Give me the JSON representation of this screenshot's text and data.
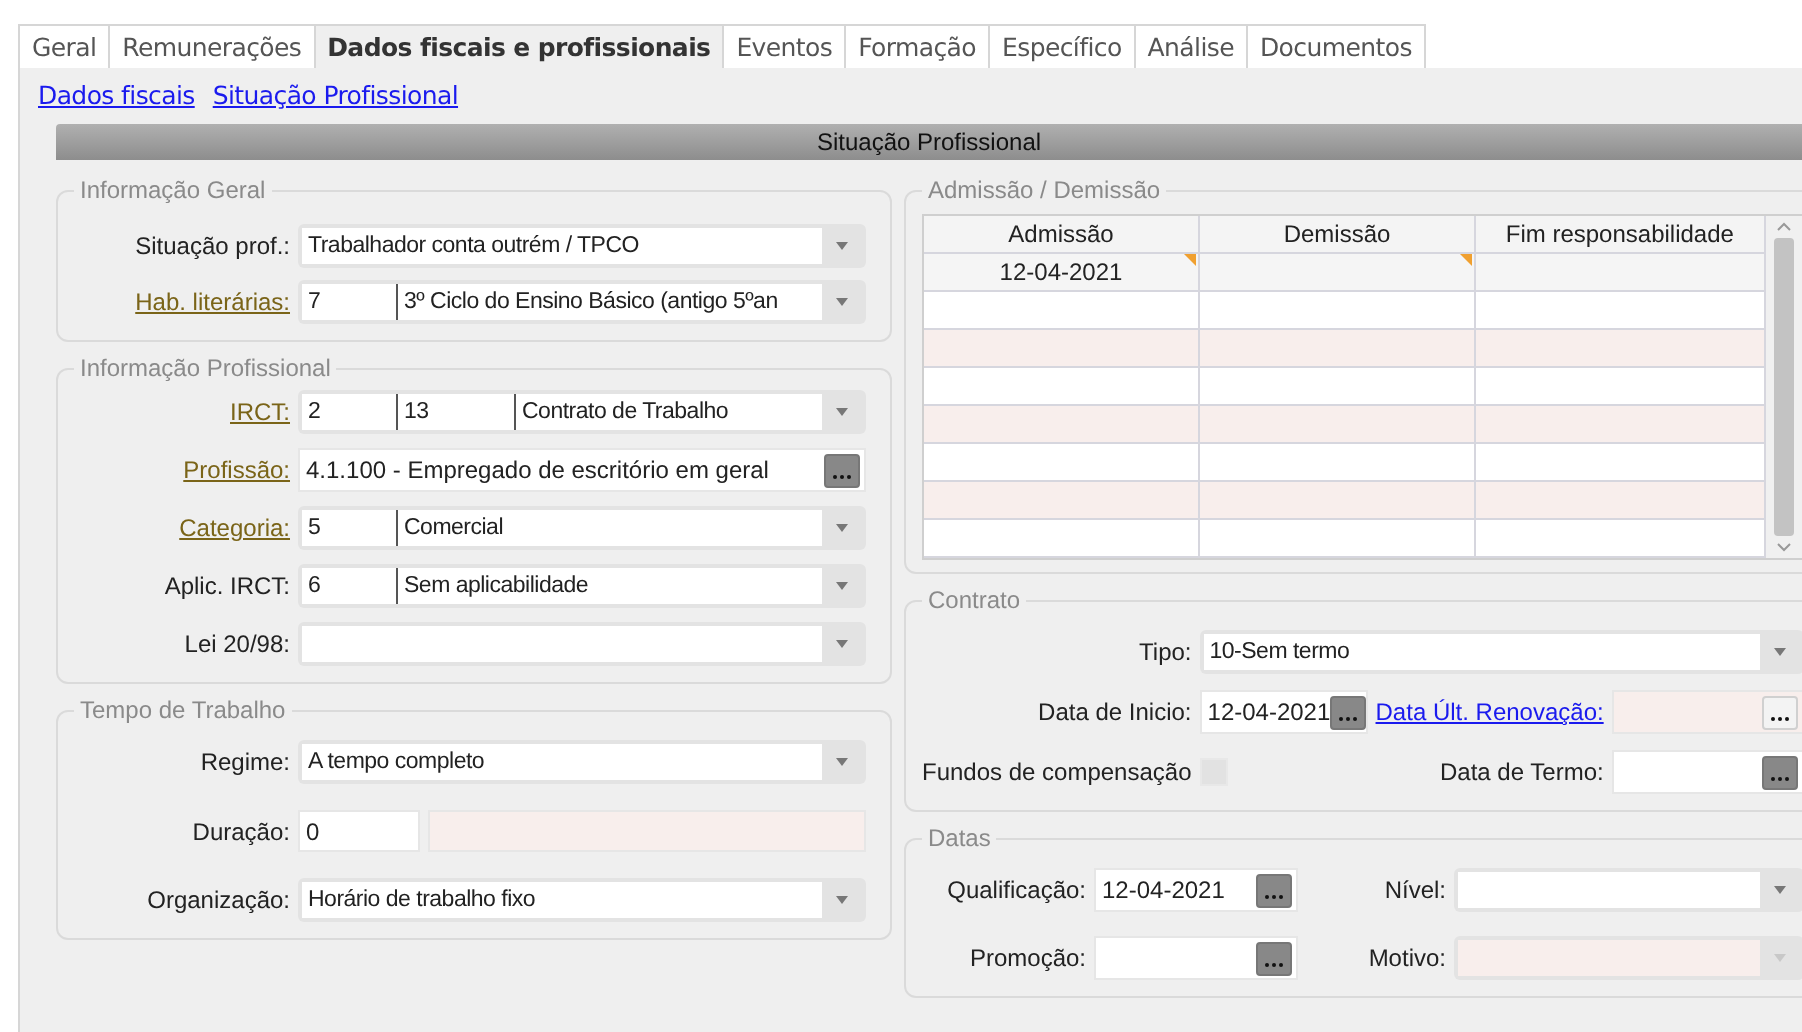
{
  "tabs": [
    {
      "label": "Geral",
      "selected": false
    },
    {
      "label": "Remunerações",
      "selected": false
    },
    {
      "label": "Dados fiscais e profissionais",
      "selected": true
    },
    {
      "label": "Eventos",
      "selected": false
    },
    {
      "label": "Formação",
      "selected": false
    },
    {
      "label": "Específico",
      "selected": false
    },
    {
      "label": "Análise",
      "selected": false
    },
    {
      "label": "Documentos",
      "selected": false
    }
  ],
  "links": [
    "Dados fiscais",
    "Situação Profissional"
  ],
  "section_title": "Situação Profissional",
  "left_groups": [
    {
      "title": "Informação Geral",
      "fields": [
        {
          "label": "Situação prof.:",
          "link": false,
          "kind": "combo",
          "parts": [
            "Trabalhador conta outrém / TPCO"
          ]
        },
        {
          "label": "Hab. literárias:",
          "link": true,
          "kind": "combo",
          "parts": [
            "7",
            "3º Ciclo do Ensino Básico (antigo 5ºan"
          ]
        }
      ]
    },
    {
      "title": "Informação Profissional",
      "fields": [
        {
          "label": "IRCT:",
          "link": true,
          "kind": "combo",
          "parts": [
            "2",
            "13",
            "Contrato de Trabalho"
          ]
        },
        {
          "label": "Profissão:",
          "link": true,
          "kind": "lookup",
          "value": "4.1.100 - Empregado de escritório em geral"
        },
        {
          "label": "Categoria:",
          "link": true,
          "kind": "combo",
          "parts": [
            "5",
            "Comercial"
          ]
        },
        {
          "label": "Aplic. IRCT:",
          "link": false,
          "kind": "combo",
          "parts": [
            "6",
            "Sem aplicabilidade"
          ]
        },
        {
          "label": "Lei 20/98:",
          "link": false,
          "kind": "combo"
        }
      ]
    },
    {
      "title": "Tempo de Trabalho",
      "fields": [
        {
          "label": "Regime:",
          "link": false,
          "kind": "combo",
          "parts": [
            "A tempo completo"
          ]
        },
        {
          "label": "Duração:",
          "link": false,
          "kind": "duration",
          "value": "0"
        },
        {
          "label": "Organização:",
          "link": false,
          "kind": "combo",
          "parts": [
            "Horário de trabalho fixo"
          ]
        }
      ]
    }
  ],
  "admission": {
    "title": "Admissão / Demissão",
    "columns": [
      "Admissão",
      "Demissão",
      "Fim responsabilidade"
    ],
    "rows": [
      {
        "cells": [
          {
            "text": "12-04-2021",
            "flagged": true
          },
          {
            "flagged": true
          },
          {
            "flagged": false
          }
        ]
      }
    ]
  },
  "contract": {
    "title": "Contrato",
    "fields": [
      {
        "label": "Tipo:",
        "link": false,
        "kind": "combo",
        "wide": true,
        "parts": [
          "10-Sem termo"
        ]
      },
      {
        "label": "Data de Inicio:",
        "link": false,
        "kind": "date",
        "value": "12-04-2021"
      },
      {
        "label": "Data Últ. Renovação:",
        "link": true,
        "kind": "date",
        "disabled": true
      },
      {
        "label": "Fundos de compensação",
        "link": false,
        "kind": "checkbox",
        "checked": false
      },
      {
        "label": "Data de Termo:",
        "link": false,
        "kind": "date"
      }
    ]
  },
  "dates": {
    "title": "Datas",
    "fields": [
      {
        "label": "Qualificação:",
        "link": false,
        "kind": "date",
        "value": "12-04-2021"
      },
      {
        "label": "Nível:",
        "link": false,
        "kind": "combo"
      },
      {
        "label": "Promoção:",
        "link": false,
        "kind": "date"
      },
      {
        "label": "Motivo:",
        "link": false,
        "kind": "combo",
        "disabled": true
      }
    ]
  }
}
